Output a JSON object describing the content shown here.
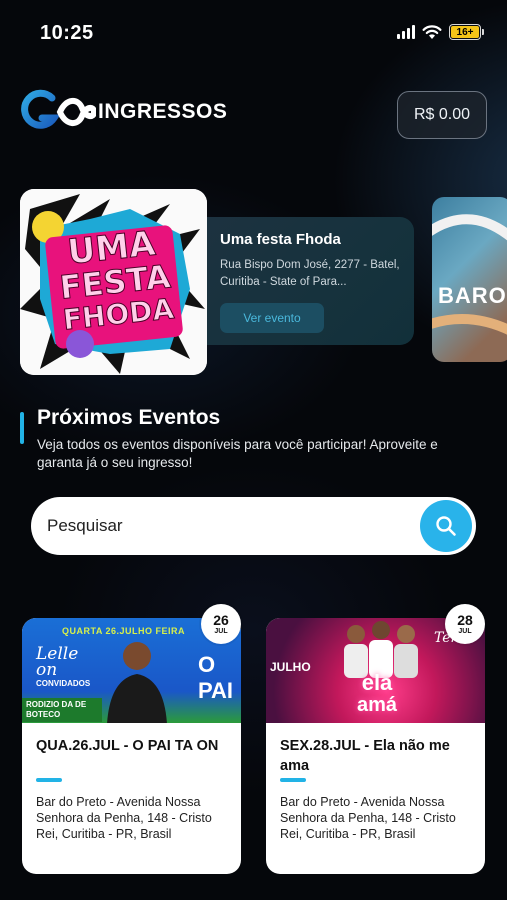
{
  "status_bar": {
    "time": "10:25",
    "battery": "16+"
  },
  "header": {
    "logo_text": "INGRESSOS",
    "balance": "R$ 0.00"
  },
  "featured": {
    "poster_text": [
      "UMA",
      "FESTA",
      "FHODA"
    ],
    "title": "Uma festa Fhoda",
    "address": "Rua Bispo Dom José, 2277 - Batel, Curitiba - State of Para...",
    "button_label": "Ver evento",
    "next_poster_text": "BARO"
  },
  "section": {
    "title": "Próximos Eventos",
    "subtitle": "Veja todos os eventos disponíveis para você participar! Aproveite e garanta já o seu ingresso!"
  },
  "search": {
    "placeholder": "Pesquisar"
  },
  "events": [
    {
      "day": "26",
      "month": "JUL",
      "title": "QUA.26.JUL - O PAI TA ON",
      "address": "Bar do Preto - Avenida Nossa Senhora da Penha, 148 - Cristo Rei, Curitiba - PR, Brasil",
      "banner": {
        "top": "QUARTA 26.JULHO FEIRA",
        "left_1": "Lelle on",
        "left_2": "CONVIDADOS",
        "right": "O PAI",
        "bottom": "RODIZIO DA DE BOTECO"
      }
    },
    {
      "day": "28",
      "month": "JUL",
      "title": "SEX.28.JUL - Ela não me ama",
      "address": "Bar do Preto - Avenida Nossa Senhora da Penha, 148 - Cristo Rei, Curitiba - PR, Brasil",
      "banner": {
        "left": "JULHO",
        "center_1": "ela",
        "center_2": "amá",
        "right": "Terzo"
      }
    }
  ],
  "colors": {
    "accent": "#22b3e6",
    "background": "#05070b",
    "card": "#ffffff"
  }
}
